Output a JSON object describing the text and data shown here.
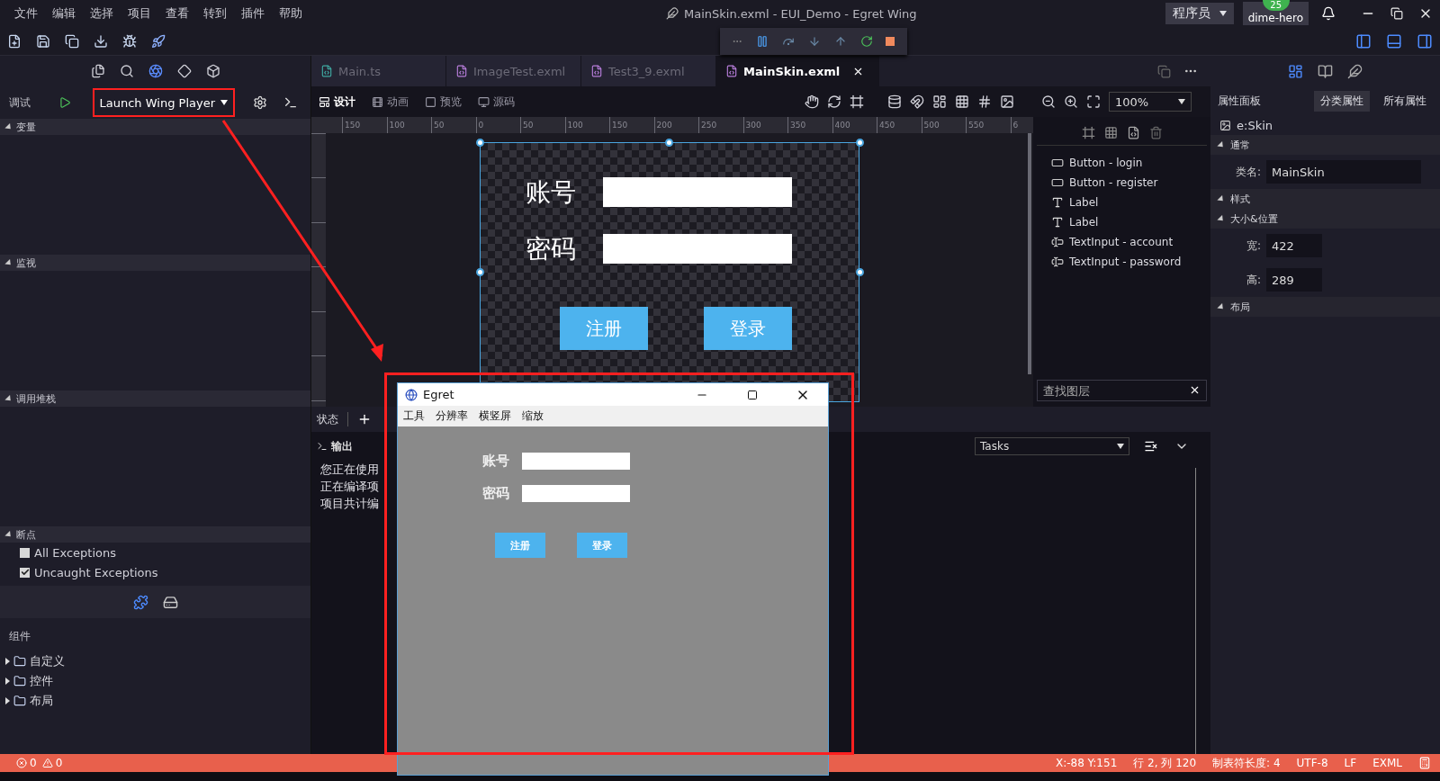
{
  "window": {
    "title": "MainSkin.exml - EUI_Demo - Egret Wing"
  },
  "menu": [
    "文件",
    "编辑",
    "选择",
    "项目",
    "查看",
    "转到",
    "插件",
    "帮助"
  ],
  "account": {
    "role": "程序员",
    "user": "dime-hero",
    "badge": "25"
  },
  "left_panel": {
    "debug_label": "调试",
    "launch": "Launch Wing Player",
    "sections": [
      {
        "title": "变量",
        "expanded": true
      },
      {
        "title": "监视",
        "expanded": true
      },
      {
        "title": "调用堆栈",
        "expanded": true
      },
      {
        "title": "断点",
        "expanded": true
      }
    ],
    "breakpoints": [
      {
        "label": "All Exceptions",
        "checked": false
      },
      {
        "label": "Uncaught Exceptions",
        "checked": true
      }
    ],
    "components_title": "组件",
    "component_tree": [
      {
        "label": "自定义",
        "expanded": false
      },
      {
        "label": "控件",
        "expanded": false
      },
      {
        "label": "布局",
        "expanded": false
      }
    ]
  },
  "editor": {
    "tabs": [
      {
        "label": "Main.ts",
        "kind": "ts",
        "selected": false
      },
      {
        "label": "ImageTest.exml",
        "kind": "exml",
        "selected": false
      },
      {
        "label": "Test3_9.exml",
        "kind": "exml",
        "selected": false
      },
      {
        "label": "MainSkin.exml",
        "kind": "exml",
        "selected": true
      }
    ],
    "views": [
      {
        "label": "设计",
        "selected": true
      },
      {
        "label": "动画",
        "selected": false
      },
      {
        "label": "预览",
        "selected": false
      },
      {
        "label": "源码",
        "selected": false
      }
    ],
    "zoom": "100%",
    "ruler_ticks": [
      "150",
      "100",
      "50",
      "0",
      "50",
      "100",
      "150",
      "200",
      "250",
      "300",
      "350",
      "400",
      "450",
      "500",
      "550",
      "6"
    ],
    "skin": {
      "labels": [
        "账号",
        "密码"
      ],
      "buttons": [
        "注册",
        "登录"
      ]
    },
    "layers": [
      {
        "label": "Button - login",
        "kind": "button"
      },
      {
        "label": "Button - register",
        "kind": "button"
      },
      {
        "label": "Label",
        "kind": "label"
      },
      {
        "label": "Label",
        "kind": "label"
      },
      {
        "label": "TextInput - account",
        "kind": "textinput"
      },
      {
        "label": "TextInput - password",
        "kind": "textinput"
      }
    ],
    "layer_search": {
      "placeholder": "查找图层"
    },
    "state_label": "状态"
  },
  "output": {
    "tab": "输出",
    "lines": [
      "您正在使用",
      "正在编译项",
      "项目共计编"
    ],
    "tasks": "Tasks"
  },
  "properties": {
    "title": "属性面板",
    "tabs": [
      {
        "label": "分类属性",
        "selected": true
      },
      {
        "label": "所有属性",
        "selected": false
      }
    ],
    "element": "e:Skin",
    "groups": [
      {
        "title": "通常",
        "fields": [
          {
            "label": "类名:",
            "value": "MainSkin",
            "wide": true
          }
        ]
      },
      {
        "title": "样式"
      },
      {
        "title": "大小&位置",
        "fields": [
          {
            "label": "宽:",
            "value": "422",
            "wide": false
          },
          {
            "label": "高:",
            "value": "289",
            "wide": false
          }
        ]
      },
      {
        "title": "布局"
      }
    ]
  },
  "status_bar": {
    "errors": "0",
    "warnings": "0",
    "items": [
      "X:-88 Y:151",
      "行 2, 列 120",
      "制表符长度: 4",
      "UTF-8",
      "LF",
      "EXML"
    ]
  },
  "player": {
    "title": "Egret",
    "menu": [
      "工具",
      "分辨率",
      "横竖屏",
      "缩放"
    ],
    "labels": [
      "账号",
      "密码"
    ],
    "buttons": [
      "注册",
      "登录"
    ]
  }
}
